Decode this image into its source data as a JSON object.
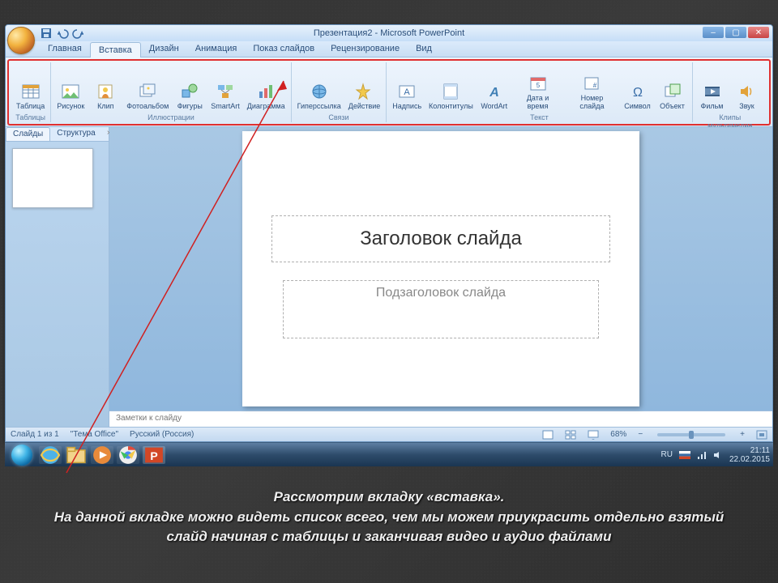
{
  "window": {
    "title": "Презентация2 - Microsoft PowerPoint",
    "qat": {
      "save": "save",
      "undo": "undo",
      "redo": "redo"
    },
    "tabs": {
      "home": "Главная",
      "insert": "Вставка",
      "design": "Дизайн",
      "animation": "Анимация",
      "slideshow": "Показ слайдов",
      "review": "Рецензирование",
      "view": "Вид"
    }
  },
  "ribbon": {
    "groups": {
      "tables": {
        "label": "Таблицы",
        "items": {
          "table": "Таблица"
        }
      },
      "illus": {
        "label": "Иллюстрации",
        "items": {
          "picture": "Рисунок",
          "clip": "Клип",
          "album": "Фотоальбом",
          "shapes": "Фигуры",
          "smartart": "SmartArt",
          "chart": "Диаграмма"
        }
      },
      "links": {
        "label": "Связи",
        "items": {
          "hyperlink": "Гиперссылка",
          "action": "Действие"
        }
      },
      "text": {
        "label": "Текст",
        "items": {
          "textbox": "Надпись",
          "headerfooter": "Колонтитулы",
          "wordart": "WordArt",
          "datetime": "Дата и время",
          "slidenum": "Номер слайда",
          "symbol": "Символ",
          "object": "Объект"
        }
      },
      "media": {
        "label": "Клипы мультимедиа",
        "items": {
          "movie": "Фильм",
          "sound": "Звук"
        }
      }
    }
  },
  "leftpane": {
    "tabs": {
      "slides": "Слайды",
      "outline": "Структура"
    }
  },
  "slide": {
    "title_placeholder": "Заголовок слайда",
    "subtitle_placeholder": "Подзаголовок слайда"
  },
  "notes": {
    "placeholder": "Заметки к слайду"
  },
  "status": {
    "slide": "Слайд 1 из 1",
    "theme": "\"Тема Office\"",
    "lang": "Русский (Россия)",
    "zoom_text": "68%"
  },
  "taskbar": {
    "lang": "RU",
    "time": "21:11",
    "date": "22.02.2015"
  },
  "caption": {
    "line1": "Рассмотрим вкладку «вставка».",
    "line2": "На данной вкладке можно видеть список всего, чем мы можем приукрасить отдельно взятый слайд начиная с таблицы и заканчивая видео и аудио файлами"
  }
}
